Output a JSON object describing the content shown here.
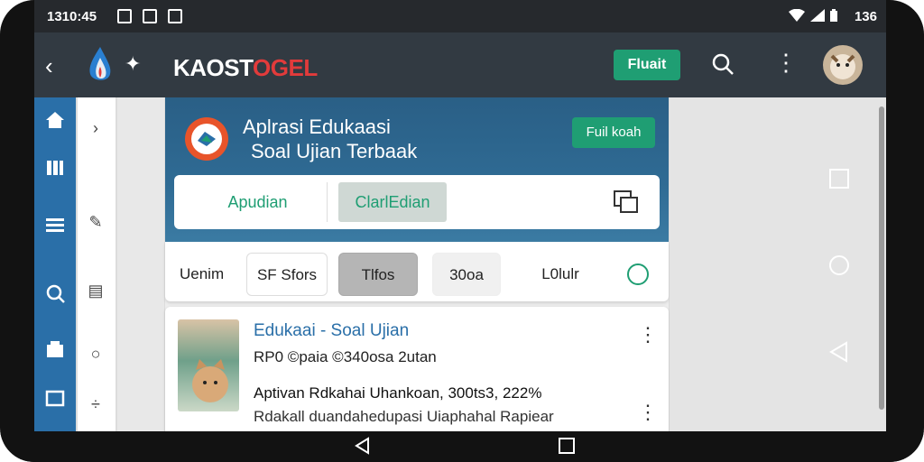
{
  "status": {
    "time": "1310:45",
    "battery": "136"
  },
  "appbar": {
    "brand_a": "KAOST",
    "brand_b": "OGEL",
    "action_label": "Fluait"
  },
  "hero": {
    "title": "Aplrasi Edukaasi",
    "subtitle": "Soal Ujian Terbaak",
    "button_label": "Fuil koah"
  },
  "tabs": {
    "tab1": "Apudian",
    "tab2": "ClarlEdian"
  },
  "filters": {
    "label": "Uenim",
    "chips": [
      "SF Sfors",
      "Tlfos",
      "30oa",
      "L0lulr"
    ]
  },
  "card": {
    "title": "Edukaai - Soal Ujian",
    "meta": "RP0 ©paia ©340osa 2utan",
    "desc": "Aptivan Rdkahai Uhankoan, 300ts3, 222%",
    "excerpt": "Rdakall duandahedupasi Uiaphahal Rapiear"
  },
  "colors": {
    "accent": "#1f9e73",
    "appbar": "#323a42",
    "rail": "#2a6fa8",
    "brand_red": "#e23b3b"
  }
}
